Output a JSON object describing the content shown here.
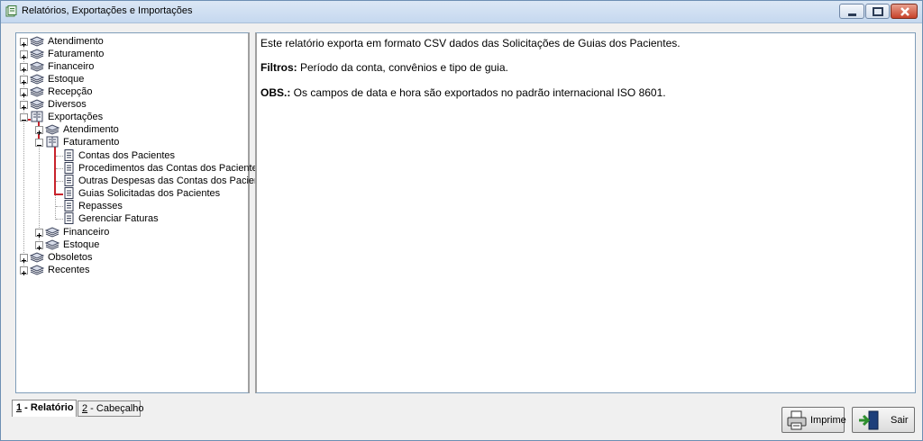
{
  "window": {
    "title": "Relatórios, Exportações e Importações"
  },
  "tree": {
    "atendimento": "Atendimento",
    "faturamento": "Faturamento",
    "financeiro": "Financeiro",
    "estoque": "Estoque",
    "recepcao": "Recepção",
    "diversos": "Diversos",
    "exportacoes": "Exportações",
    "exp_atendimento": "Atendimento",
    "exp_faturamento": "Faturamento",
    "contas": "Contas dos Pacientes",
    "procedimentos": "Procedimentos das Contas dos Pacientes",
    "outras": "Outras Despesas das Contas dos Pacientes",
    "guias": "Guias Solicitadas dos Pacientes",
    "repasses": "Repasses",
    "gerenciar": "Gerenciar Faturas",
    "exp_financeiro": "Financeiro",
    "exp_estoque": "Estoque",
    "obsoletos": "Obsoletos",
    "recentes": "Recentes"
  },
  "description": {
    "line1": "Este relatório exporta em formato CSV dados das Solicitações de Guias dos Pacientes.",
    "filtros_label": "Filtros:",
    "filtros_text": " Período da conta, convênios e tipo de guia.",
    "obs_label": "OBS.:",
    "obs_text": " Os campos de data e hora são exportados no padrão internacional  ISO 8601."
  },
  "tabs": {
    "t1_key": "1",
    "t1_rest": " - Relatório",
    "t2_key": "2",
    "t2_rest": " - Cabeçalho"
  },
  "buttons": {
    "imprime": "Imprime",
    "sair": "Sair"
  }
}
